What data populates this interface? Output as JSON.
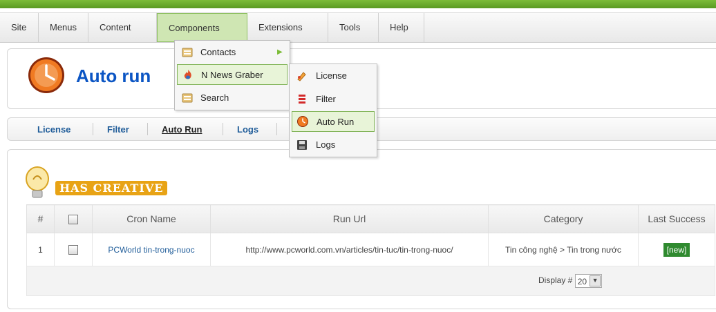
{
  "menu": [
    "Site",
    "Menus",
    "Content",
    "Components",
    "Extensions",
    "Tools",
    "Help"
  ],
  "page": {
    "title": "Auto run"
  },
  "tabs": [
    "License",
    "Filter",
    "Auto Run",
    "Logs"
  ],
  "logo": {
    "text": "HAS CREATIVE"
  },
  "components_menu": [
    "Contacts",
    "N News Graber",
    "Search"
  ],
  "submenu": [
    "License",
    "Filter",
    "Auto Run",
    "Logs"
  ],
  "table": {
    "headers": [
      "#",
      "",
      "Cron Name",
      "Run Url",
      "Category",
      "Last Success"
    ],
    "rows": [
      {
        "num": "1",
        "cron_name": "PCWorld tin-trong-nuoc",
        "run_url": "http://www.pcworld.com.vn/articles/tin-tuc/tin-trong-nuoc/",
        "category": "Tin công nghệ > Tin trong nước",
        "last_success": "[new]"
      }
    ],
    "display_label": "Display #",
    "display_value": "20"
  },
  "colors": {
    "accent_green": "#7cbc38",
    "link_blue": "#1f5c99",
    "title_blue": "#0b55c4"
  }
}
